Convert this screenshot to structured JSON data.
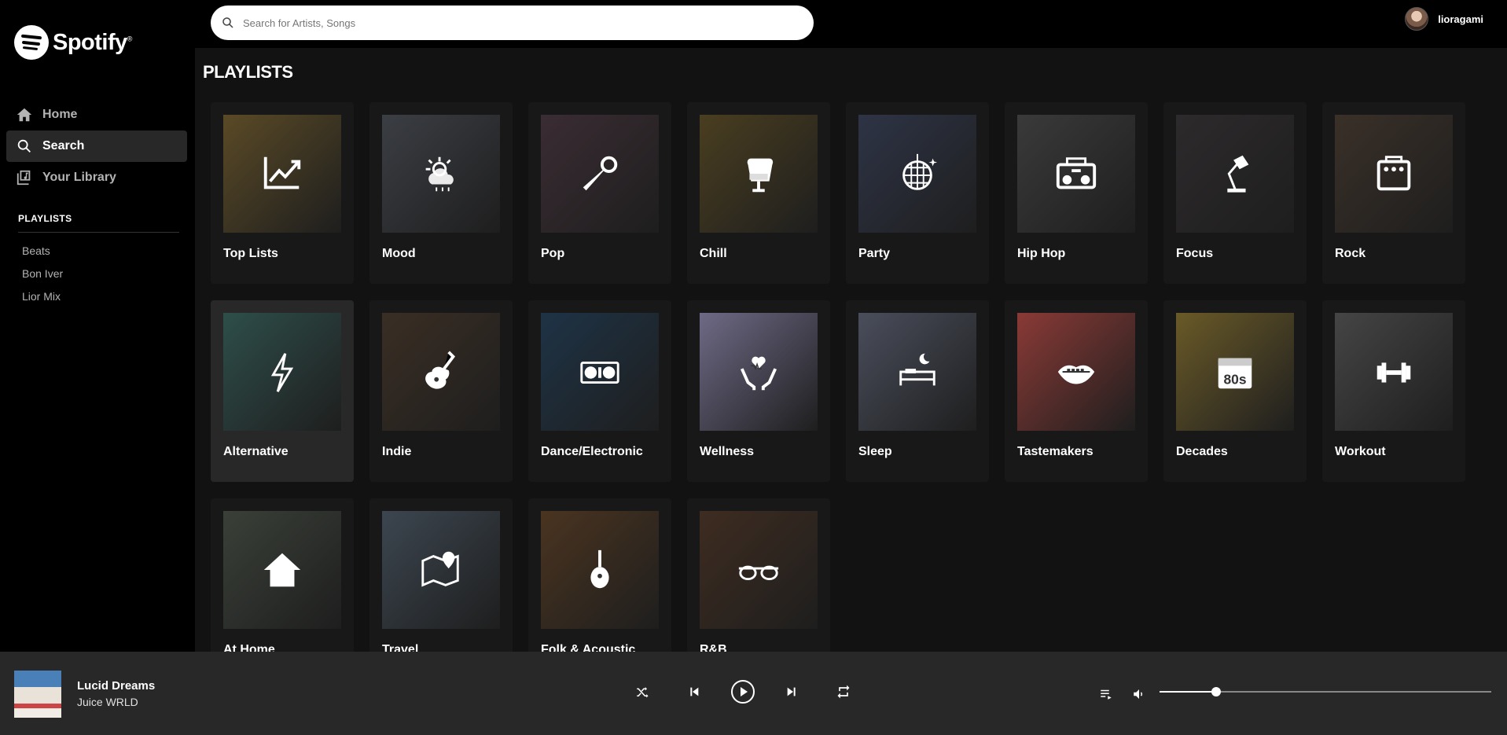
{
  "app": {
    "name": "Spotify"
  },
  "sidebar": {
    "nav": [
      {
        "label": "Home",
        "icon": "home-icon"
      },
      {
        "label": "Search",
        "icon": "search-icon",
        "active": true
      },
      {
        "label": "Your Library",
        "icon": "library-icon"
      }
    ],
    "playlists_heading": "PLAYLISTS",
    "playlists": [
      "Beats",
      "Bon Iver",
      "Lior Mix"
    ]
  },
  "search": {
    "placeholder": "Search for Artists, Songs",
    "value": ""
  },
  "user": {
    "name": "lioragami"
  },
  "main": {
    "title": "PLAYLISTS",
    "categories": [
      {
        "label": "Top Lists",
        "icon": "trending-chart-icon",
        "bg": "#5a4a26"
      },
      {
        "label": "Mood",
        "icon": "sun-cloud-icon",
        "bg": "#3b3e44"
      },
      {
        "label": "Pop",
        "icon": "microphone-icon",
        "bg": "#3a2c33"
      },
      {
        "label": "Chill",
        "icon": "egg-chair-icon",
        "bg": "#4a3e20"
      },
      {
        "label": "Party",
        "icon": "disco-ball-icon",
        "bg": "#2e3446"
      },
      {
        "label": "Hip Hop",
        "icon": "boombox-icon",
        "bg": "#3a3a3a"
      },
      {
        "label": "Focus",
        "icon": "desk-lamp-icon",
        "bg": "#2d2a2c"
      },
      {
        "label": "Rock",
        "icon": "amplifier-icon",
        "bg": "#3a3028"
      },
      {
        "label": "Alternative",
        "icon": "lightning-icon",
        "bg": "#2e4e4a"
      },
      {
        "label": "Indie",
        "icon": "electric-guitar-icon",
        "bg": "#3a2e24"
      },
      {
        "label": "Dance/Electronic",
        "icon": "turntables-icon",
        "bg": "#1e3346"
      },
      {
        "label": "Wellness",
        "icon": "hands-heart-icon",
        "bg": "#6e6a86"
      },
      {
        "label": "Sleep",
        "icon": "bed-moon-icon",
        "bg": "#4a4e5c"
      },
      {
        "label": "Tastemakers",
        "icon": "lips-icon",
        "bg": "#8a3a36"
      },
      {
        "label": "Decades",
        "icon": "calendar-80s-icon",
        "bg": "#6a5a28"
      },
      {
        "label": "Workout",
        "icon": "dumbbell-icon",
        "bg": "#454545"
      },
      {
        "label": "At Home",
        "icon": "house-icon",
        "bg": "#3a4038"
      },
      {
        "label": "Travel",
        "icon": "map-pin-icon",
        "bg": "#3c4650"
      },
      {
        "label": "Folk & Acoustic",
        "icon": "mandolin-icon",
        "bg": "#4a3420"
      },
      {
        "label": "R&B",
        "icon": "glasses-icon",
        "bg": "#3e2c20"
      }
    ]
  },
  "player": {
    "title": "Lucid Dreams",
    "artist": "Juice WRLD",
    "controls": [
      "shuffle-icon",
      "previous-icon",
      "play-icon",
      "next-icon",
      "repeat-icon"
    ],
    "volume": 0.17
  },
  "colors": {
    "sidebar_bg": "#000000",
    "main_bg": "#121212",
    "card_bg": "#181818",
    "player_bg": "#282828"
  }
}
